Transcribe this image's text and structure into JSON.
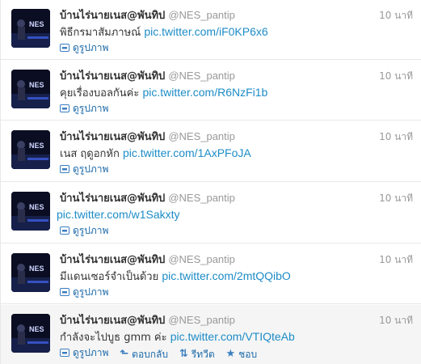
{
  "tweets": [
    {
      "fullname": "บ้านไร่นายเนส@พันทิป",
      "username": "@NES_pantip",
      "time": "10 นาที",
      "text": "พิธีกรมาสัมภาษณ์",
      "link": "pic.twitter.com/iF0KP6x6",
      "view_photo": "ดูรูปภาพ"
    },
    {
      "fullname": "บ้านไร่นายเนส@พันทิป",
      "username": "@NES_pantip",
      "time": "10 นาที",
      "text": "คุยเรื่องบอลกันค่ะ",
      "link": "pic.twitter.com/R6NzFi1b",
      "view_photo": "ดูรูปภาพ"
    },
    {
      "fullname": "บ้านไร่นายเนส@พันทิป",
      "username": "@NES_pantip",
      "time": "10 นาที",
      "text": "เนส ฤดูอกหัก",
      "link": "pic.twitter.com/1AxPFoJA",
      "view_photo": "ดูรูปภาพ"
    },
    {
      "fullname": "บ้านไร่นายเนส@พันทิป",
      "username": "@NES_pantip",
      "time": "10 นาที",
      "text": "",
      "link": "pic.twitter.com/w1Sakxty",
      "view_photo": "ดูรูปภาพ"
    },
    {
      "fullname": "บ้านไร่นายเนส@พันทิป",
      "username": "@NES_pantip",
      "time": "10 นาที",
      "text": "มีแดนเซอร์จำเป็นด้วย",
      "link": "pic.twitter.com/2mtQQibO",
      "view_photo": "ดูรูปภาพ"
    },
    {
      "fullname": "บ้านไร่นายเนส@พันทิป",
      "username": "@NES_pantip",
      "time": "10 นาที",
      "text": "กำลังจะไปบูธ gmm ค่ะ",
      "link": "pic.twitter.com/VTIQteAb",
      "view_photo": "ดูรูปภาพ",
      "reply": "ตอบกลับ",
      "retweet": "รีทวีต",
      "favorite": "ชอบ"
    }
  ],
  "colors": {
    "link": "#1d8cc7",
    "action": "#1d6aa9",
    "muted": "#999999",
    "hover_bg": "#f5f5f5"
  },
  "icons": [
    "avatar-image",
    "photo-icon",
    "reply-icon",
    "retweet-icon",
    "favorite-star-icon"
  ]
}
